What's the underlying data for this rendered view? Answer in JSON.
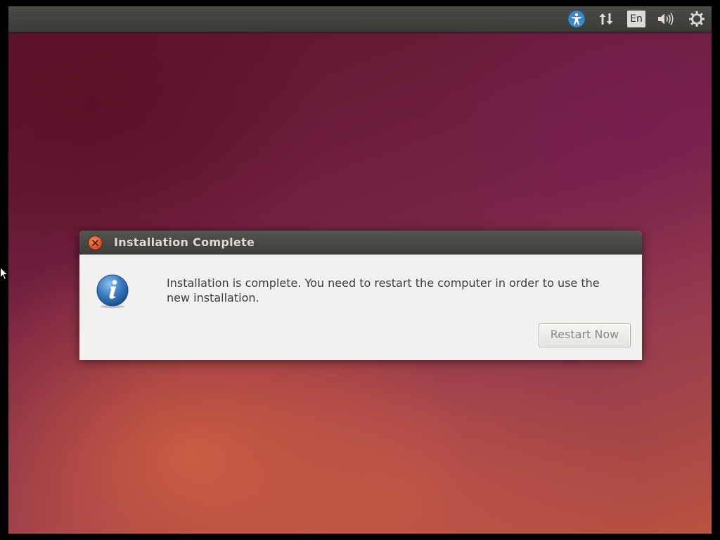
{
  "top_panel": {
    "icons": [
      "accessibility-icon",
      "network-icon",
      "keyboard-layout-indicator",
      "volume-icon",
      "settings-gear-icon"
    ],
    "keyboard_layout": "En",
    "colors": {
      "panel": "#3c3b37",
      "accessibility": "#3a86c8"
    }
  },
  "dialog": {
    "title": "Installation Complete",
    "message_line1": "Installation is complete. You need to restart the computer in order to use the",
    "message_line2": "new installation.",
    "restart_button_label": "Restart Now",
    "icon": "info-icon",
    "close_icon": "close-icon",
    "colors": {
      "titlebar": "#3c3b37",
      "body": "#f2f1f0",
      "close": "#e05a2a"
    }
  }
}
